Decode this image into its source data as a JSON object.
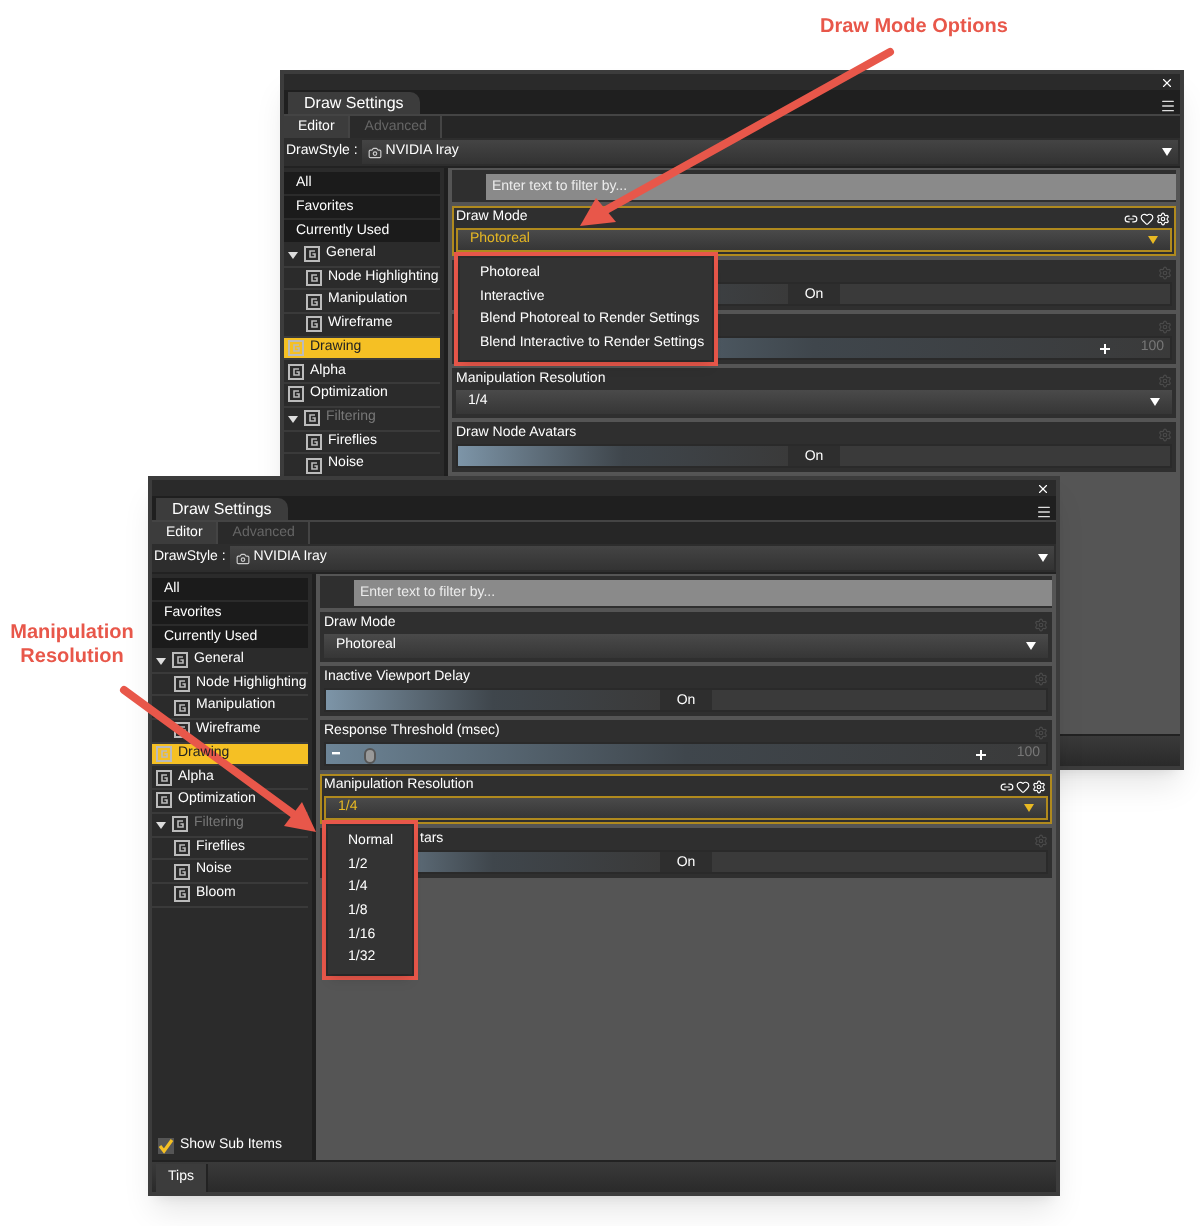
{
  "annotations": [
    {
      "text": "Draw Mode Options"
    },
    {
      "text": "Manipulation Resolution"
    }
  ],
  "panels": [
    {
      "title": "Draw Settings",
      "tabs": [
        {
          "label": "Editor",
          "selected": true,
          "disabled": false
        },
        {
          "label": "Advanced",
          "selected": false,
          "disabled": true
        }
      ],
      "drawstyle": {
        "label": "DrawStyle :",
        "value": "NVIDIA Iray"
      },
      "sidebar": [
        {
          "kind": "filter",
          "label": "All",
          "selected": false
        },
        {
          "kind": "filter",
          "label": "Favorites",
          "selected": false
        },
        {
          "kind": "filter",
          "label": "Currently Used",
          "selected": false
        },
        {
          "kind": "group",
          "label": "General",
          "selected": false,
          "disabled": false,
          "expanded": true,
          "children": [
            {
              "kind": "group",
              "label": "Node Highlighting",
              "selected": false,
              "disabled": false
            },
            {
              "kind": "group",
              "label": "Manipulation",
              "selected": false,
              "disabled": false
            },
            {
              "kind": "group",
              "label": "Wireframe",
              "selected": false,
              "disabled": false
            }
          ]
        },
        {
          "kind": "group",
          "label": "Drawing",
          "selected": true,
          "disabled": false
        },
        {
          "kind": "group",
          "label": "Alpha",
          "selected": false,
          "disabled": false
        },
        {
          "kind": "group",
          "label": "Optimization",
          "selected": false,
          "disabled": false
        },
        {
          "kind": "group",
          "label": "Filtering",
          "selected": false,
          "disabled": true,
          "expanded": true,
          "children": [
            {
              "kind": "group",
              "label": "Fireflies",
              "selected": false,
              "disabled": false
            },
            {
              "kind": "group",
              "label": "Noise",
              "selected": false,
              "disabled": false
            }
          ]
        }
      ],
      "filter": {
        "placeholder": "Enter text to filter by..."
      },
      "rows": [
        {
          "kind": "dropdown",
          "label": "Draw Mode",
          "value": "Photoreal",
          "selected": true,
          "open": true,
          "options": [
            "Photoreal",
            "Interactive",
            "Blend Photoreal to Render Settings",
            "Blend Interactive to Render Settings"
          ]
        },
        {
          "kind": "toggle",
          "value": "On"
        },
        {
          "kind": "slider",
          "reading": "100"
        },
        {
          "kind": "dropdown",
          "label": "Manipulation Resolution",
          "value": "1/4",
          "selected": false,
          "open": false
        },
        {
          "kind": "toggle",
          "label": "Draw Node Avatars",
          "value": "On"
        }
      ]
    },
    {
      "title": "Draw Settings",
      "tabs": [
        {
          "label": "Editor",
          "selected": true,
          "disabled": false
        },
        {
          "label": "Advanced",
          "selected": false,
          "disabled": true
        }
      ],
      "drawstyle": {
        "label": "DrawStyle :",
        "value": "NVIDIA Iray"
      },
      "sidebar": [
        {
          "kind": "filter",
          "label": "All",
          "selected": false
        },
        {
          "kind": "filter",
          "label": "Favorites",
          "selected": false
        },
        {
          "kind": "filter",
          "label": "Currently Used",
          "selected": false
        },
        {
          "kind": "group",
          "label": "General",
          "selected": false,
          "disabled": false,
          "expanded": true,
          "children": [
            {
              "kind": "group",
              "label": "Node Highlighting",
              "selected": false,
              "disabled": false
            },
            {
              "kind": "group",
              "label": "Manipulation",
              "selected": false,
              "disabled": false
            },
            {
              "kind": "group",
              "label": "Wireframe",
              "selected": false,
              "disabled": false
            }
          ]
        },
        {
          "kind": "group",
          "label": "Drawing",
          "selected": true,
          "disabled": false
        },
        {
          "kind": "group",
          "label": "Alpha",
          "selected": false,
          "disabled": false
        },
        {
          "kind": "group",
          "label": "Optimization",
          "selected": false,
          "disabled": false
        },
        {
          "kind": "group",
          "label": "Filtering",
          "selected": false,
          "disabled": true,
          "expanded": true,
          "children": [
            {
              "kind": "group",
              "label": "Fireflies",
              "selected": false,
              "disabled": false
            },
            {
              "kind": "group",
              "label": "Noise",
              "selected": false,
              "disabled": false
            },
            {
              "kind": "group",
              "label": "Bloom",
              "selected": false,
              "disabled": false
            }
          ]
        }
      ],
      "filter": {
        "placeholder": "Enter text to filter by..."
      },
      "rows": [
        {
          "kind": "dropdown",
          "label": "Draw Mode",
          "value": "Photoreal",
          "selected": false,
          "open": false
        },
        {
          "kind": "toggle",
          "label": "Inactive Viewport Delay",
          "value": "On"
        },
        {
          "kind": "slider",
          "label": "Response Threshold (msec)",
          "level": 0.03,
          "reading": "100"
        },
        {
          "kind": "dropdown",
          "label": "Manipulation Resolution",
          "value": "1/4",
          "selected": true,
          "open": true,
          "options": [
            "Normal",
            "1/2",
            "1/4",
            "1/8",
            "1/16",
            "1/32"
          ]
        },
        {
          "kind": "toggle",
          "label": "tars",
          "value": "On"
        }
      ],
      "show_sub_items": {
        "label": "Show Sub Items",
        "checked": true
      },
      "footer_tab": "Tips"
    }
  ]
}
